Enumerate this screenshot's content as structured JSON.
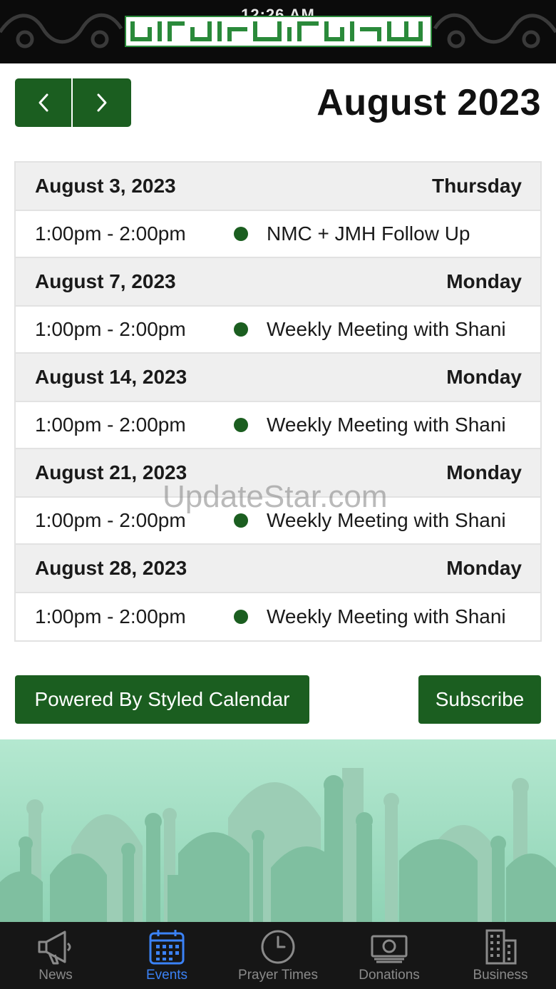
{
  "status_bar": {
    "time": "12:26 AM"
  },
  "calendar": {
    "month_title": "August 2023",
    "days": [
      {
        "date": "August 3, 2023",
        "weekday": "Thursday",
        "events": [
          {
            "time": "1:00pm - 2:00pm",
            "title": "NMC + JMH Follow Up"
          }
        ]
      },
      {
        "date": "August 7, 2023",
        "weekday": "Monday",
        "events": [
          {
            "time": "1:00pm - 2:00pm",
            "title": "Weekly Meeting with Shani"
          }
        ]
      },
      {
        "date": "August 14, 2023",
        "weekday": "Monday",
        "events": [
          {
            "time": "1:00pm - 2:00pm",
            "title": "Weekly Meeting with Shani"
          }
        ]
      },
      {
        "date": "August 21, 2023",
        "weekday": "Monday",
        "events": [
          {
            "time": "1:00pm - 2:00pm",
            "title": "Weekly Meeting with Shani"
          }
        ]
      },
      {
        "date": "August 28, 2023",
        "weekday": "Monday",
        "events": [
          {
            "time": "1:00pm - 2:00pm",
            "title": "Weekly Meeting with Shani"
          }
        ]
      }
    ]
  },
  "buttons": {
    "powered_label": "Powered By Styled Calendar",
    "subscribe_label": "Subscribe"
  },
  "watermark": "UpdateStar.com",
  "tabs": [
    {
      "label": "News",
      "icon": "megaphone-icon"
    },
    {
      "label": "Events",
      "icon": "calendar-icon",
      "active": true
    },
    {
      "label": "Prayer Times",
      "icon": "clock-icon"
    },
    {
      "label": "Donations",
      "icon": "money-icon"
    },
    {
      "label": "Business",
      "icon": "building-icon"
    }
  ],
  "colors": {
    "primary_green": "#1b5e20",
    "active_tab": "#3b82f6",
    "header_bg": "#0b0b0b",
    "tabbar_bg": "#161616"
  }
}
